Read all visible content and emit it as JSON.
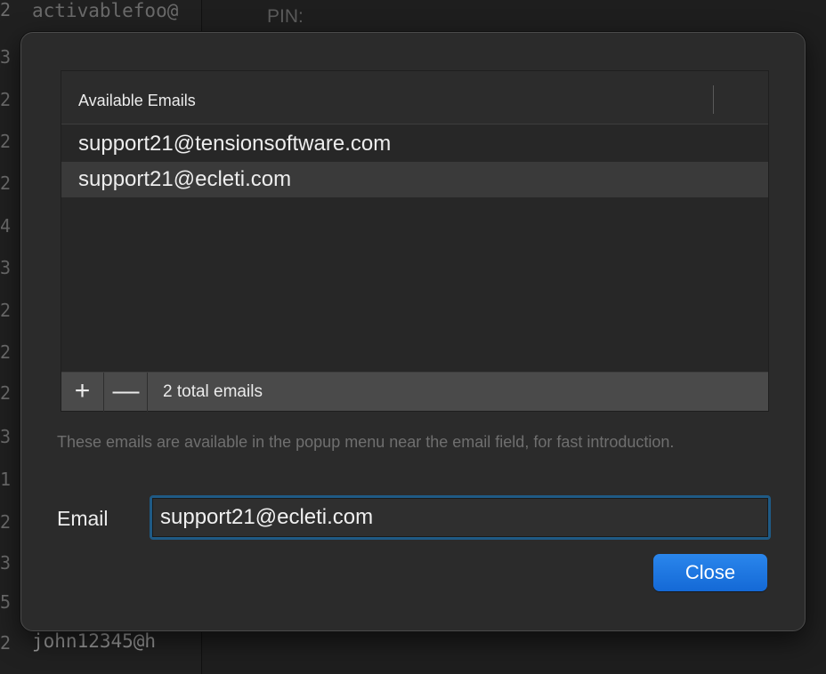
{
  "background": {
    "top_text": "activablefoo@",
    "pin_label": "PIN:",
    "bottom_text": "john12345@h",
    "row_numbers": [
      "2",
      "3",
      "2",
      "2",
      "2",
      "4",
      "3",
      "2",
      "2",
      "2",
      "3",
      "1",
      "2",
      "3",
      "5",
      "2"
    ]
  },
  "sheet": {
    "table": {
      "header_label": "Available Emails",
      "rows": [
        "support21@tensionsoftware.com",
        "support21@ecleti.com"
      ],
      "selected_index": 1,
      "add_label": "+",
      "remove_label": "—",
      "count_label": "2 total emails"
    },
    "help_text": "These emails are available in the popup menu near the email field, for fast introduction.",
    "email": {
      "label": "Email",
      "value": "support21@ecleti.com"
    },
    "close_label": "Close"
  },
  "colors": {
    "accent": "#1a75e0",
    "focus_ring": "#1f5a85",
    "sheet_bg": "#2b2b2b"
  }
}
